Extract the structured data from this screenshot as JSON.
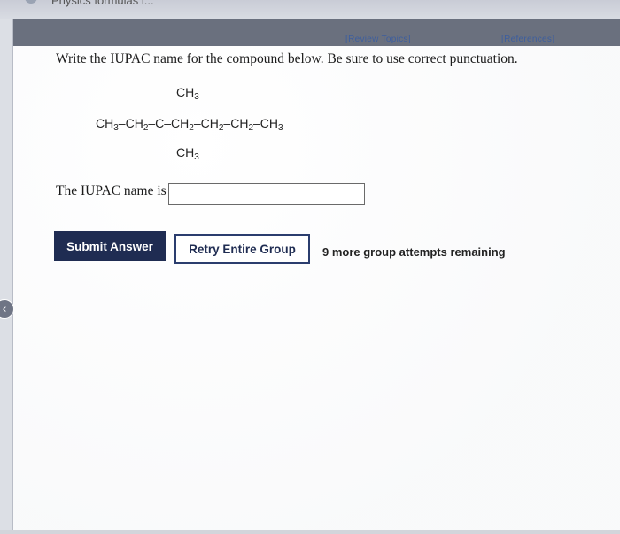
{
  "browser_tab": {
    "title": "Physics formulas l..."
  },
  "header": {
    "review_topics": "[Review Topics]",
    "references": "[References]"
  },
  "question": {
    "prompt": "Write the IUPAC name for the compound below. Be sure to use correct punctuation.",
    "structure": {
      "top_substituent": "CH3",
      "main_chain": "CH3–CH2–C–CH2–CH2–CH2–CH3",
      "bottom_substituent": "CH3"
    },
    "answer_label": "The IUPAC name is",
    "answer_value": ""
  },
  "actions": {
    "submit_label": "Submit Answer",
    "retry_label": "Retry Entire Group",
    "attempts_text": "9 more group attempts remaining"
  },
  "colors": {
    "primary_button": "#1f2c52",
    "link": "#3d5e9e",
    "header_bar": "#6a707e"
  }
}
